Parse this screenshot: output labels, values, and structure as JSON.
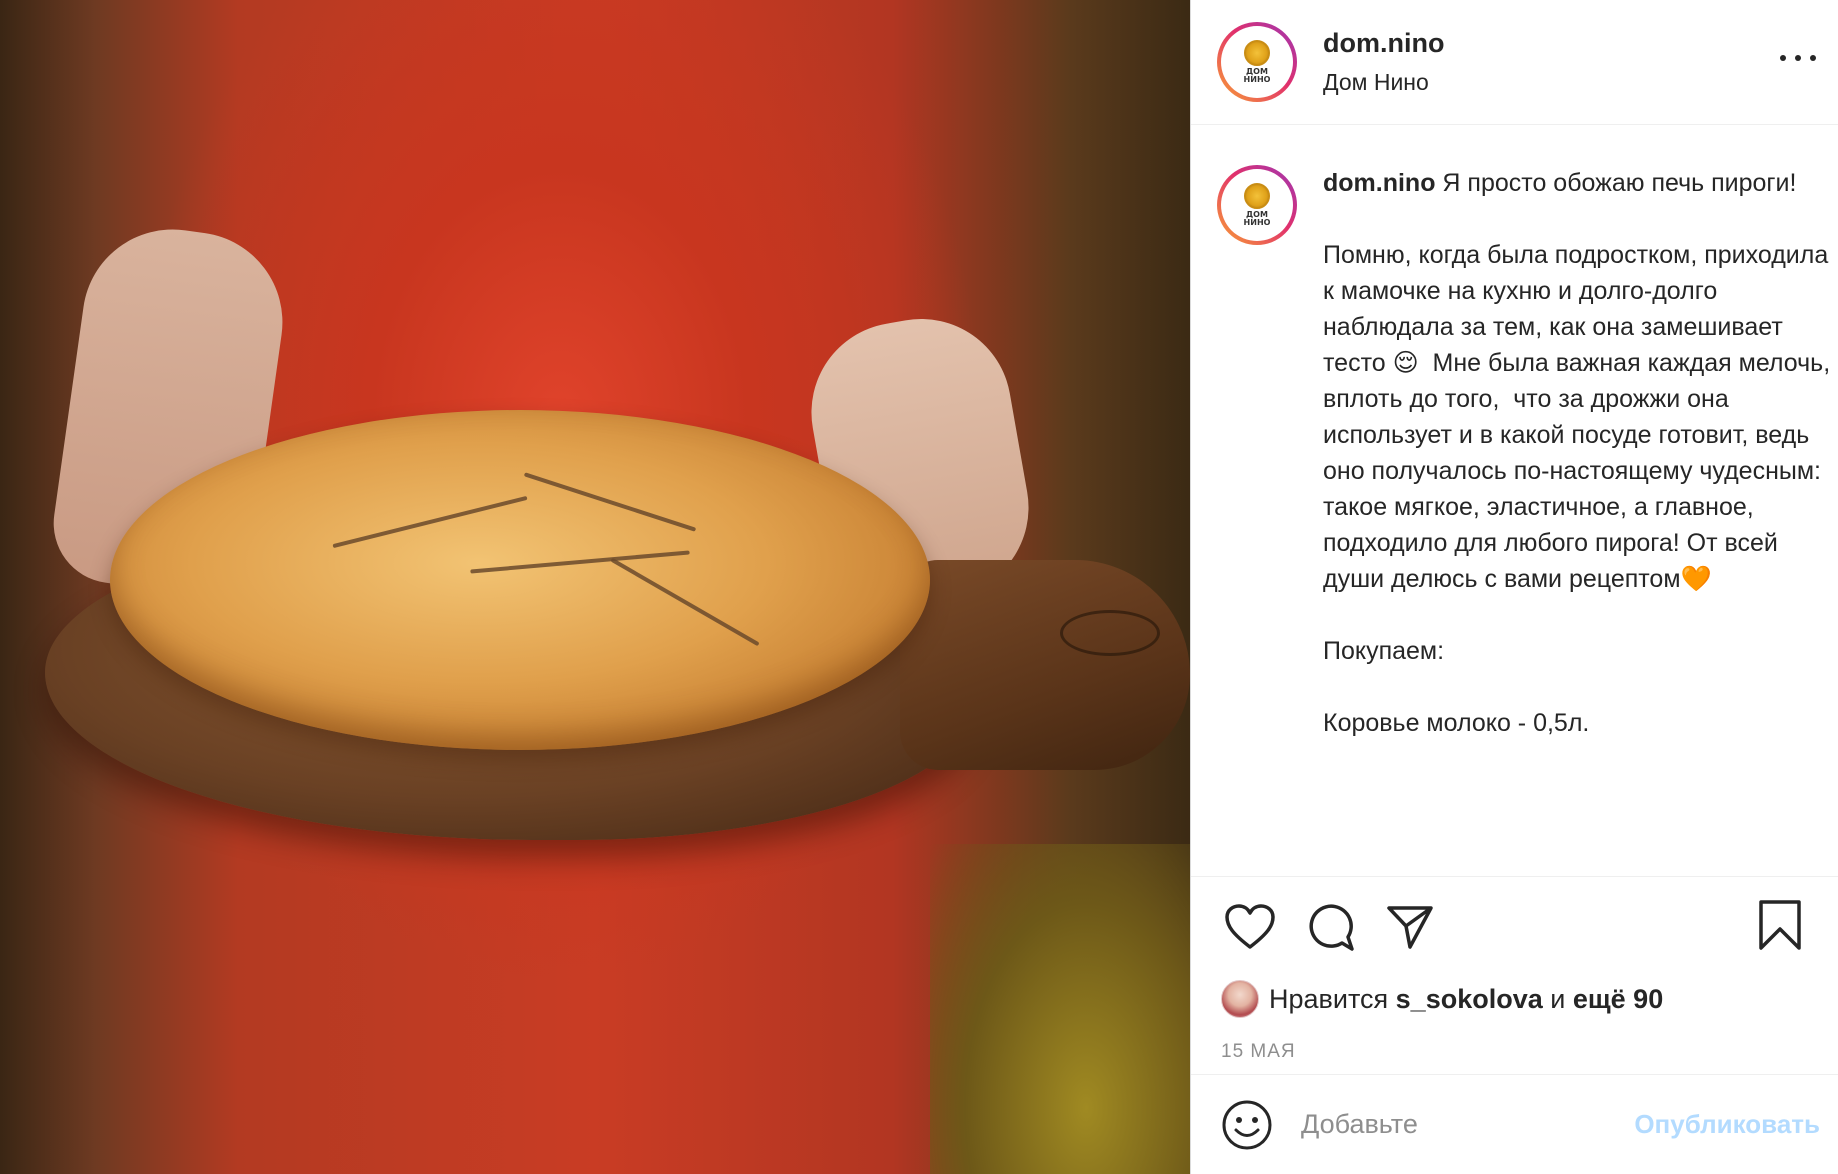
{
  "post": {
    "username": "dom.nino",
    "location": "Дом Нино",
    "logo_text": "ДОМ\nНИНО",
    "more_icon": "more-horizontal-icon",
    "caption": {
      "username": "dom.nino",
      "text": " Я просто обожаю печь пироги!\n\nПомню, когда была подростком, приходила к мамочке на кухню и долго-долго наблюдала за тем, как она замешивает тесто 😌  Мне была важная каждая мелочь, вплоть до того,  что за дрожжи она использует и в какой посуде готовит, ведь оно получалось по-настоящему чудесным: такое мягкое, эластичное, а главное, подходило для любого пирога! От всей души делюсь с вами рецептом🧡\n\nПокупаем:\n\nКоровье молоко - 0,5л."
    },
    "actions": {
      "like_icon": "heart-icon",
      "comment_icon": "comment-icon",
      "share_icon": "send-icon",
      "save_icon": "bookmark-icon"
    },
    "likes": {
      "prefix": "Нравится",
      "user": "s_sokolova",
      "conj": "и",
      "rest": "ещё 90"
    },
    "date": "15 МАЯ",
    "comment": {
      "emoji_icon": "smile-icon",
      "placeholder": "Добавьте",
      "publish_label": "Опубликовать"
    },
    "colors": {
      "accent_link": "#b3dbff",
      "text": "#262626",
      "muted": "#8e8e8e"
    }
  }
}
